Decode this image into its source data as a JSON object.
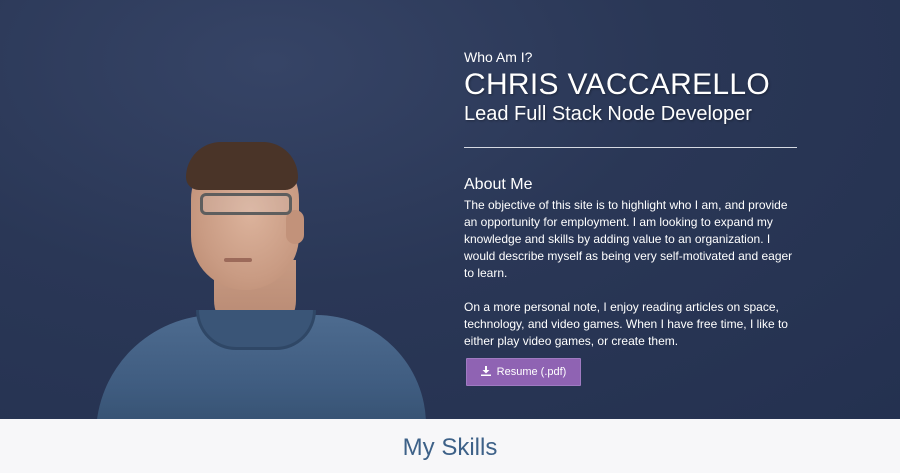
{
  "hero": {
    "subtitle": "Who Am I?",
    "name": "CHRIS VACCARELLO",
    "role": "Lead Full Stack Node Developer"
  },
  "about": {
    "title": "About Me",
    "paragraphs": [
      "The objective of this site is to highlight who I am, and provide an opportunity for employment. I am looking to expand my knowledge and skills by adding value to an organization. I would describe myself as being very self-motivated and eager to learn.",
      "On a more personal note, I enjoy reading articles on space, technology, and video games. When I have free time, I like to either play video games, or create them."
    ]
  },
  "resume_button": {
    "label": "Resume (.pdf)",
    "icon": "download-icon"
  },
  "skills": {
    "title": "My Skills"
  },
  "colors": {
    "hero_background": "#2a3756",
    "button": "#8f63b3",
    "skills_title": "#3d6188"
  }
}
